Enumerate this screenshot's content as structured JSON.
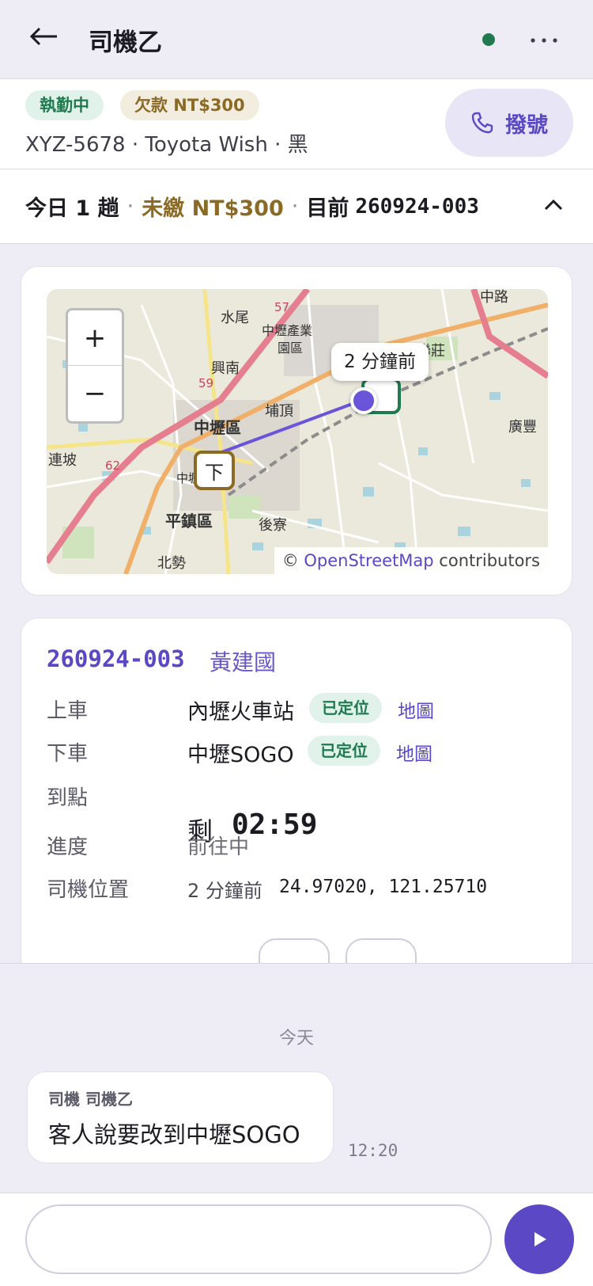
{
  "header": {
    "title": "司機乙",
    "back_icon": "arrow-left-icon",
    "more_icon": "more-horizontal-icon",
    "online_color": "#1f7a4f"
  },
  "driver": {
    "status_badge": "執勤中",
    "debt_badge": "欠款 NT$300",
    "vehicle": "XYZ-5678 · Toyota Wish · 黑",
    "call_label": "撥號"
  },
  "summary": {
    "trips_today": "今日 1 趟",
    "separator": "·",
    "unpaid": "未繳 NT$300",
    "current_label": "目前",
    "current_trip": "260924-003"
  },
  "map": {
    "zoom_in": "+",
    "zoom_out": "−",
    "tooltip": "2 分鐘前",
    "drop_marker_label": "下",
    "attribution_prefix": "©",
    "attribution_link": "OpenStreetMap",
    "attribution_suffix": "contributors",
    "place_labels": [
      "水尾",
      "中壢產業",
      "園區",
      "興南",
      "埔頂",
      "中壢區",
      "連坡",
      "平鎮區",
      "後寮",
      "北勢",
      "中路",
      "聯莊",
      "廣豐",
      "中壢車站",
      "57",
      "59",
      "62"
    ]
  },
  "trip": {
    "code": "260924-003",
    "passenger": "黃建國",
    "pickup_label": "上車",
    "pickup_value": "內壢火車站",
    "dropoff_label": "下車",
    "dropoff_value": "中壢SOGO",
    "located_badge": "已定位",
    "map_link": "地圖",
    "arrival_label": "到點",
    "eta_prefix": "剩",
    "eta_time": "02:59",
    "progress_label": "進度",
    "progress_value": "前往中",
    "driver_loc_label": "司機位置",
    "driver_loc_time": "2 分鐘前",
    "driver_loc_coords": "24.97020, 121.25710"
  },
  "chat": {
    "date_divider": "今天",
    "messages": [
      {
        "sender": "司機 司機乙",
        "text": "客人說要改到中壢SOGO",
        "time": "12:20"
      }
    ]
  },
  "composer": {
    "placeholder": "",
    "send_icon": "play-send-icon",
    "accent": "#5a48c4"
  }
}
